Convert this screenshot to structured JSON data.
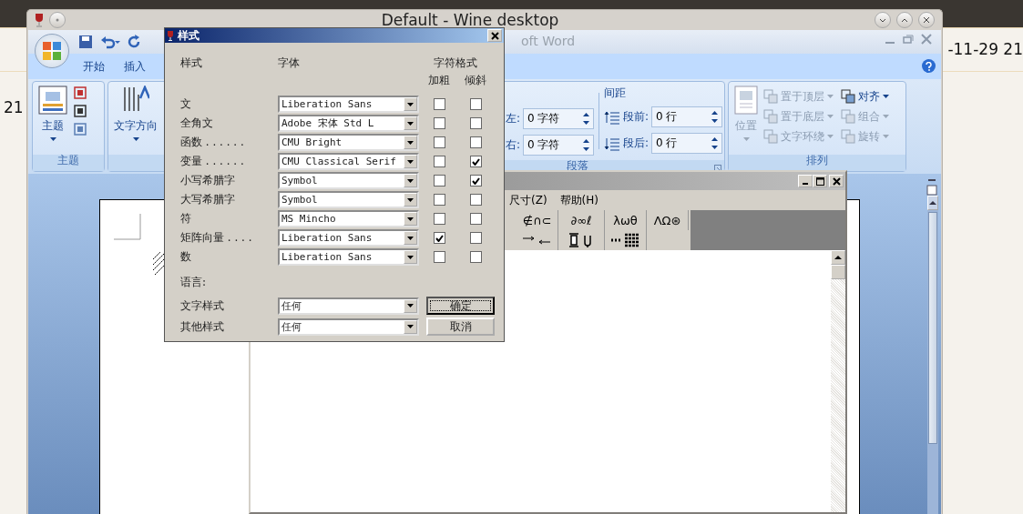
{
  "desktop": {
    "left_text": "21",
    "right_text": "-11-29 21"
  },
  "wine_window": {
    "title": "Default - Wine desktop"
  },
  "word": {
    "title": "oft Word",
    "tabs": [
      {
        "label": "开始",
        "selected": false
      },
      {
        "label": "插入",
        "selected": false
      }
    ],
    "theme_group": {
      "button": "主题",
      "label": "主题"
    },
    "text_direction": "文字方向",
    "paragraph": {
      "left_label": "左:",
      "left_value": "0 字符",
      "right_label": "右:",
      "right_value": "0 字符",
      "spacing_heading": "间距",
      "before_label": "段前:",
      "before_value": "0 行",
      "after_label": "段后:",
      "after_value": "0 行",
      "label": "段落"
    },
    "arrange": {
      "position": {
        "label": "位置",
        "disabled": true
      },
      "items": [
        {
          "label": "置于顶层",
          "disabled": true
        },
        {
          "label": "对齐",
          "disabled": false
        },
        {
          "label": "置于底层",
          "disabled": true
        },
        {
          "label": "组合",
          "disabled": true
        },
        {
          "label": "文字环绕",
          "disabled": true
        },
        {
          "label": "旋转",
          "disabled": true
        }
      ],
      "label": "排列"
    }
  },
  "equation_editor": {
    "menu": [
      "尺寸(Z)",
      "帮助(H)"
    ],
    "palette": [
      "∉∩⊂",
      "∂∞ℓ",
      "λωθ",
      "ΛΩ⊛"
    ]
  },
  "styles_dialog": {
    "title": "样式",
    "headers": {
      "style": "样式",
      "font": "字体",
      "format": "字符格式",
      "bold": "加粗",
      "italic": "倾斜"
    },
    "rows": [
      {
        "label": "文",
        "font": "Liberation Sans",
        "bold": false,
        "italic": false
      },
      {
        "label": "全角文",
        "font": "Adobe 宋体 Std L",
        "bold": false,
        "italic": false
      },
      {
        "label": "函数 . . . . . .",
        "font": "CMU Bright",
        "bold": false,
        "italic": false
      },
      {
        "label": "变量 . . . . . .",
        "font": "CMU Classical Serif",
        "bold": false,
        "italic": true
      },
      {
        "label": "小写希腊字",
        "font": "Symbol",
        "bold": false,
        "italic": true
      },
      {
        "label": "大写希腊字",
        "font": "Symbol",
        "bold": false,
        "italic": false
      },
      {
        "label": "符",
        "font": "MS Mincho",
        "bold": false,
        "italic": false
      },
      {
        "label": "矩阵向量 . . . .",
        "font": "Liberation Sans",
        "bold": true,
        "italic": false
      },
      {
        "label": "数",
        "font": "Liberation Sans",
        "bold": false,
        "italic": false
      }
    ],
    "language_label": "语言:",
    "language_rows": [
      {
        "label": "文字样式",
        "value": "任何"
      },
      {
        "label": "其他样式",
        "value": "任何"
      }
    ],
    "buttons": [
      {
        "label": "确定",
        "default": true
      },
      {
        "label": "取消",
        "default": false
      }
    ]
  }
}
